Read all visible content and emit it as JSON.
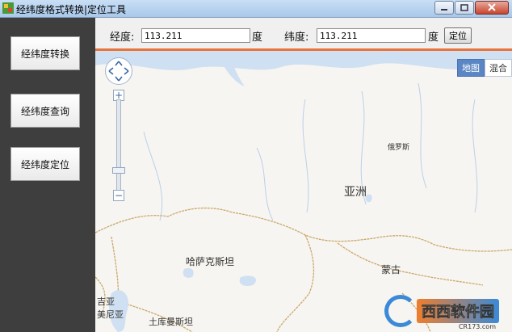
{
  "window": {
    "title": "经纬度格式转换|定位工具"
  },
  "sidebar": {
    "items": [
      {
        "label": "经纬度转换"
      },
      {
        "label": "经纬度查询"
      },
      {
        "label": "经纬度定位"
      }
    ]
  },
  "toolbar": {
    "longitude_label": "经度:",
    "longitude_value": "113.211",
    "longitude_unit": "度",
    "latitude_label": "纬度:",
    "latitude_value": "113.211",
    "latitude_unit": "度",
    "locate_label": "定位"
  },
  "map": {
    "type_buttons": [
      {
        "label": "地图"
      },
      {
        "label": "混合"
      }
    ],
    "labels": {
      "russia": "俄罗斯",
      "asia": "亚洲",
      "kazakhstan": "哈萨克斯坦",
      "mongolia": "蒙古",
      "turkmenistan": "土库曼斯坦",
      "georgia_fragment": "吉亚",
      "armenia_fragment": "美尼亚"
    },
    "watermark": {
      "text": "西西软件园",
      "sub": "CR173.com"
    }
  },
  "colors": {
    "accent": "#e8743b",
    "map_bg": "#f7f5f1",
    "water": "#cfe0f2",
    "border_line": "#c9a86b"
  }
}
